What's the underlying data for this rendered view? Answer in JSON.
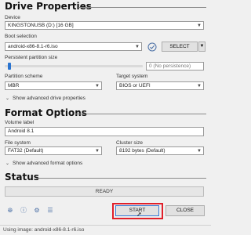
{
  "drive_properties": {
    "title": "Drive Properties",
    "device_label": "Device",
    "device_value": "KINGSTONUSB (D:) [16 GB]",
    "boot_selection_label": "Boot selection",
    "boot_selection_value": "android-x86-8.1-r6.iso",
    "select_button": "SELECT",
    "persistent_label": "Persistent partition size",
    "persistent_value": "0 (No persistence)",
    "partition_scheme_label": "Partition scheme",
    "partition_scheme_value": "MBR",
    "target_system_label": "Target system",
    "target_system_value": "BIOS or UEFI",
    "advanced_toggle": "Show advanced drive properties"
  },
  "format_options": {
    "title": "Format Options",
    "volume_label_label": "Volume label",
    "volume_label_value": "Android 8.1",
    "file_system_label": "File system",
    "file_system_value": "FAT32 (Default)",
    "cluster_size_label": "Cluster size",
    "cluster_size_value": "8192 bytes (Default)",
    "advanced_toggle": "Show advanced format options"
  },
  "status": {
    "title": "Status",
    "progress_text": "READY",
    "progress": 0
  },
  "actions": {
    "start_button": "START",
    "close_button": "CLOSE"
  },
  "statusbar": {
    "text": "Using image: android-x86-8.1-r6.iso"
  },
  "colors": {
    "highlight": "#e0202a",
    "check_icon": "#4a6fa5"
  }
}
